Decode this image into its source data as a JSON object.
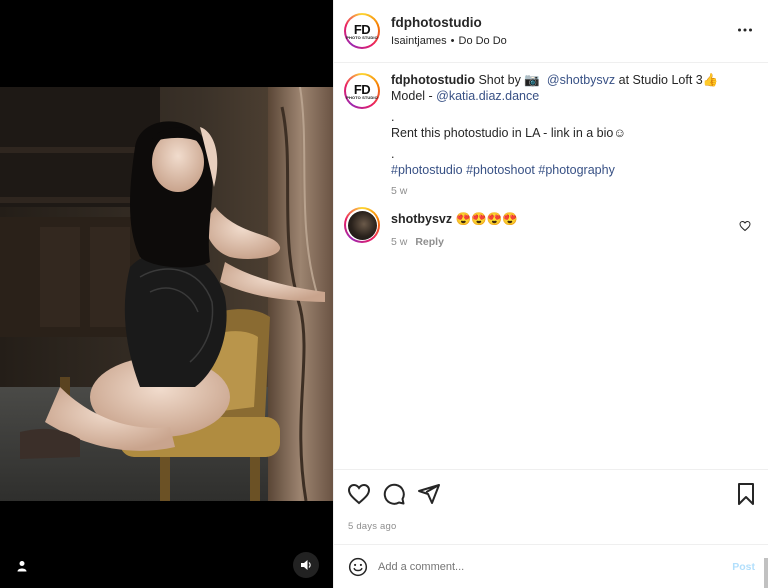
{
  "post": {
    "username": "fdphotostudio",
    "avatar_text_big": "FD",
    "avatar_text_small": "PHOTO STUDIO",
    "audio_artist": "Isaintjames",
    "audio_separator": "•",
    "audio_track": "Do Do Do",
    "more_icon": "more-horizontal-icon"
  },
  "caption": {
    "username": "fdphotostudio",
    "text_1": " Shot by ",
    "camera_emoji": "📷",
    "mention_1": "@shotbysvz",
    "text_2": " at Studio Loft 3",
    "thumb_emoji": "👍",
    "text_3": "Model - ",
    "mention_2": "@katia.diaz.dance",
    "line_dot_1": ".",
    "line_rent": "Rent this photostudio in LA - link in a bio☺",
    "line_dot_2": ".",
    "hashtag_1": "#photostudio",
    "hashtag_2": "#photoshoot",
    "hashtag_3": "#photography",
    "time": "5 w"
  },
  "comment": {
    "username": "shotbysvz",
    "text": "😍😍😍😍",
    "time": "5 w",
    "reply_label": "Reply"
  },
  "actions": {
    "like_icon": "heart-icon",
    "comment_icon": "comment-icon",
    "share_icon": "share-icon",
    "save_icon": "bookmark-icon",
    "time_ago": "5 days ago"
  },
  "composer": {
    "placeholder": "Add a comment...",
    "post_label": "Post"
  },
  "colors": {
    "link": "#385185",
    "muted": "#8e8e8e",
    "post_disabled": "#b2dffc"
  }
}
